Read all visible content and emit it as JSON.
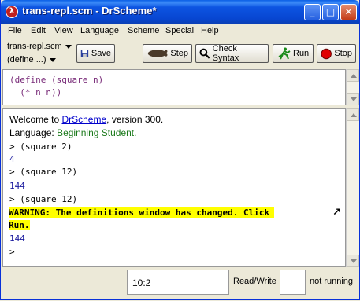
{
  "window": {
    "title": "trans-repl.scm - DrScheme*"
  },
  "menubar": {
    "items": [
      "File",
      "Edit",
      "View",
      "Language",
      "Scheme",
      "Special",
      "Help"
    ]
  },
  "toolbar": {
    "file_select": "trans-repl.scm",
    "define_select": "(define ...)",
    "save_label": "Save",
    "step_label": "Step",
    "check_syntax_label": "Check Syntax",
    "run_label": "Run",
    "stop_label": "Stop"
  },
  "definitions": {
    "lines": [
      "(define (square n)",
      "  (* n n))"
    ]
  },
  "interactions": {
    "welcome_prefix": "Welcome to ",
    "welcome_link": "DrScheme",
    "welcome_suffix": ", version 300.",
    "language_prefix": "Language: ",
    "language_value": "Beginning Student.",
    "lines": [
      {
        "kind": "input",
        "text": "> (square 2)"
      },
      {
        "kind": "output",
        "text": "4"
      },
      {
        "kind": "input",
        "text": "> (square 12)"
      },
      {
        "kind": "output",
        "text": "144"
      },
      {
        "kind": "input",
        "text": "> (square 12)"
      }
    ],
    "warning_line1": "WARNING: The definitions window has changed. Click",
    "warning_line2": "Run.",
    "after_output": "144",
    "prompt": ">"
  },
  "statusbar": {
    "position": "10:2",
    "mode": "Read/Write",
    "run_status": "not running"
  },
  "colors": {
    "titlebar": "#0746d1",
    "warning_bg": "#ffff00",
    "definitions_text": "#782a78",
    "output_text": "#1a1a9e"
  }
}
